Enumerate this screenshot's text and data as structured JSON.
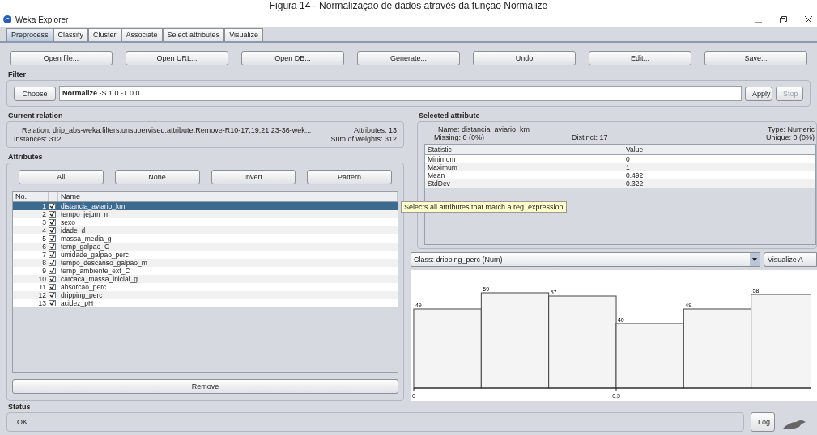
{
  "caption": "Figura 14 - Normalização de dados através da função Normalize",
  "window": {
    "title": "Weka Explorer"
  },
  "tabs": [
    {
      "label": "Preprocess",
      "selected": true
    },
    {
      "label": "Classify",
      "selected": false
    },
    {
      "label": "Cluster",
      "selected": false
    },
    {
      "label": "Associate",
      "selected": false
    },
    {
      "label": "Select attributes",
      "selected": false
    },
    {
      "label": "Visualize",
      "selected": false
    }
  ],
  "toolbar": [
    "Open file...",
    "Open URL...",
    "Open DB...",
    "Generate...",
    "Undo",
    "Edit...",
    "Save..."
  ],
  "filter": {
    "heading": "Filter",
    "choose": "Choose",
    "name": "Normalize",
    "options": "-S 1.0 -T 0.0",
    "actions": [
      {
        "label": "Apply",
        "disabled": false
      },
      {
        "label": "Stop",
        "disabled": true
      }
    ]
  },
  "current_relation": {
    "heading": "Current relation",
    "relation": "Relation: drip_abs-weka.filters.unsupervised.attribute.Remove-R10-17,19,21,23-36-wek...",
    "instances": "Instances: 312",
    "attributes": "Attributes: 13",
    "sum_of_weights": "Sum of weights: 312"
  },
  "attributes": {
    "heading": "Attributes",
    "buttons": [
      "All",
      "None",
      "Invert",
      "Pattern"
    ],
    "columns": [
      "No.",
      "Name"
    ],
    "rows": [
      {
        "no": "1",
        "name": "distancia_aviario_km",
        "checked": true,
        "selected": true
      },
      {
        "no": "2",
        "name": "tempo_jejum_m",
        "checked": true,
        "selected": false
      },
      {
        "no": "3",
        "name": "sexo",
        "checked": true,
        "selected": false
      },
      {
        "no": "4",
        "name": "idade_d",
        "checked": true,
        "selected": false
      },
      {
        "no": "5",
        "name": "massa_media_g",
        "checked": true,
        "selected": false
      },
      {
        "no": "6",
        "name": "temp_galpao_C",
        "checked": true,
        "selected": false
      },
      {
        "no": "7",
        "name": "umidade_galpao_perc",
        "checked": true,
        "selected": false
      },
      {
        "no": "8",
        "name": "tempo_descanso_galpao_m",
        "checked": true,
        "selected": false
      },
      {
        "no": "9",
        "name": "temp_ambiente_ext_C",
        "checked": true,
        "selected": false
      },
      {
        "no": "10",
        "name": "carcaca_massa_inicial_g",
        "checked": true,
        "selected": false
      },
      {
        "no": "11",
        "name": "absorcao_perc",
        "checked": true,
        "selected": false
      },
      {
        "no": "12",
        "name": "dripping_perc",
        "checked": true,
        "selected": false
      },
      {
        "no": "13",
        "name": "acidez_pH",
        "checked": true,
        "selected": false
      }
    ],
    "remove": "Remove"
  },
  "tooltip": "Selects all attributes that match a reg. expression",
  "selected_attribute": {
    "heading": "Selected attribute",
    "name": "Name: distancia_aviario_km",
    "missing": "Missing: 0 (0%)",
    "distinct": "Distinct: 17",
    "type": "Type: Numeric",
    "unique": "Unique: 0 (0%)",
    "columns": [
      "Statistic",
      "Value"
    ],
    "rows": [
      {
        "statistic": "Minimum",
        "value": "0"
      },
      {
        "statistic": "Maximum",
        "value": "1"
      },
      {
        "statistic": "Mean",
        "value": "0.492"
      },
      {
        "statistic": "StdDev",
        "value": "0.322"
      }
    ]
  },
  "class_selector": "Class: dripping_perc (Num)",
  "visualize_all": "Visualize A",
  "histogram": {
    "chart_data": {
      "type": "bar",
      "x": [
        0.0833,
        0.25,
        0.4167,
        0.5833,
        0.75,
        0.9167
      ],
      "values": [
        49,
        59,
        57,
        40,
        49,
        58
      ],
      "data_labels": true,
      "xlim": [
        0,
        0.98
      ],
      "xticks": [
        0,
        0.5
      ]
    }
  },
  "status": {
    "heading": "Status",
    "message": "OK",
    "log": "Log"
  }
}
